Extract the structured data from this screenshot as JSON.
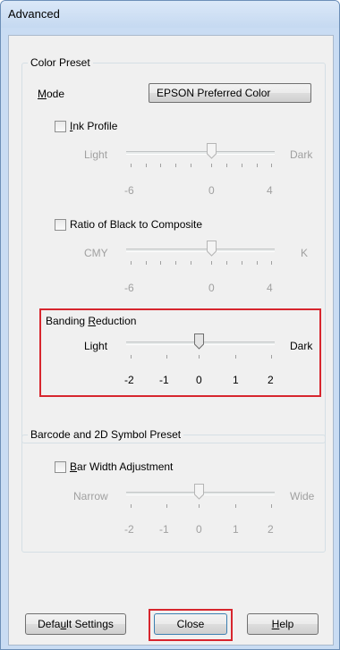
{
  "window": {
    "title": "Advanced"
  },
  "color_preset": {
    "legend": "Color Preset",
    "mode_label": "Mode",
    "mode_value": "EPSON Preferred Color",
    "ink_profile": {
      "label": "Ink Profile",
      "checked": false,
      "left_label": "Light",
      "right_label": "Dark",
      "ticks": [
        "-6",
        "0",
        "4"
      ]
    },
    "black_ratio": {
      "label": "Ratio of Black to Composite",
      "checked": false,
      "left_label": "CMY",
      "right_label": "K",
      "ticks": [
        "-6",
        "0",
        "4"
      ]
    },
    "banding": {
      "label": "Banding Reduction",
      "left_label": "Light",
      "right_label": "Dark",
      "ticks": [
        "-2",
        "-1",
        "0",
        "1",
        "2"
      ]
    }
  },
  "barcode": {
    "legend": "Barcode and 2D Symbol Preset",
    "bar_width": {
      "label": "Bar Width Adjustment",
      "checked": false,
      "left_label": "Narrow",
      "right_label": "Wide",
      "ticks": [
        "-2",
        "-1",
        "0",
        "1",
        "2"
      ]
    }
  },
  "buttons": {
    "default_settings": "Default Settings",
    "close": "Close",
    "help": "Help"
  },
  "colors": {
    "highlight": "#d7262e",
    "disabled_text": "#a0a0a0"
  }
}
